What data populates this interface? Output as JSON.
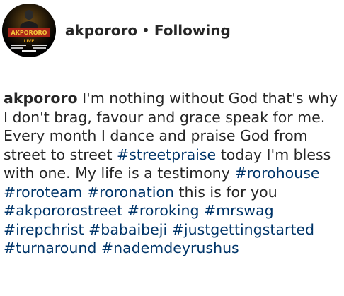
{
  "post": {
    "username": "akpororo",
    "separator": "•",
    "follow_status": "Following",
    "avatar_text": {
      "line1": "AKPORORO",
      "line2": "LIVE",
      "line3": "ROROKING"
    }
  },
  "caption": {
    "username": "akpororo",
    "segments": [
      {
        "type": "text",
        "value": " I'm nothing without God that's why I don't brag, favour and grace speak for me. Every month I dance and praise God from street to street "
      },
      {
        "type": "tag",
        "value": "#streetpraise"
      },
      {
        "type": "text",
        "value": " today I'm bless with one. My life is a testimony "
      },
      {
        "type": "tag",
        "value": "#rorohouse"
      },
      {
        "type": "text",
        "value": " "
      },
      {
        "type": "tag",
        "value": "#roroteam"
      },
      {
        "type": "text",
        "value": " "
      },
      {
        "type": "tag",
        "value": "#roronation"
      },
      {
        "type": "text",
        "value": " this is for you "
      },
      {
        "type": "tag",
        "value": "#akpororostreet"
      },
      {
        "type": "text",
        "value": " "
      },
      {
        "type": "tag",
        "value": "#roroking"
      },
      {
        "type": "text",
        "value": " "
      },
      {
        "type": "tag",
        "value": "#mrswag"
      },
      {
        "type": "text",
        "value": " "
      },
      {
        "type": "tag",
        "value": "#irepchrist"
      },
      {
        "type": "text",
        "value": " "
      },
      {
        "type": "tag",
        "value": "#babaibeji"
      },
      {
        "type": "text",
        "value": " "
      },
      {
        "type": "tag",
        "value": "#justgettingstarted"
      },
      {
        "type": "text",
        "value": " "
      },
      {
        "type": "tag",
        "value": "#turnaround"
      },
      {
        "type": "text",
        "value": " "
      },
      {
        "type": "tag",
        "value": "#nademdeyrushus"
      }
    ]
  },
  "colors": {
    "text": "#262626",
    "hashtag": "#003569",
    "divider": "#efefef",
    "avatar_gold": "#e0a020",
    "avatar_red": "#c0261b"
  },
  "icons": {
    "avatar": "profile-poster-avatar"
  }
}
